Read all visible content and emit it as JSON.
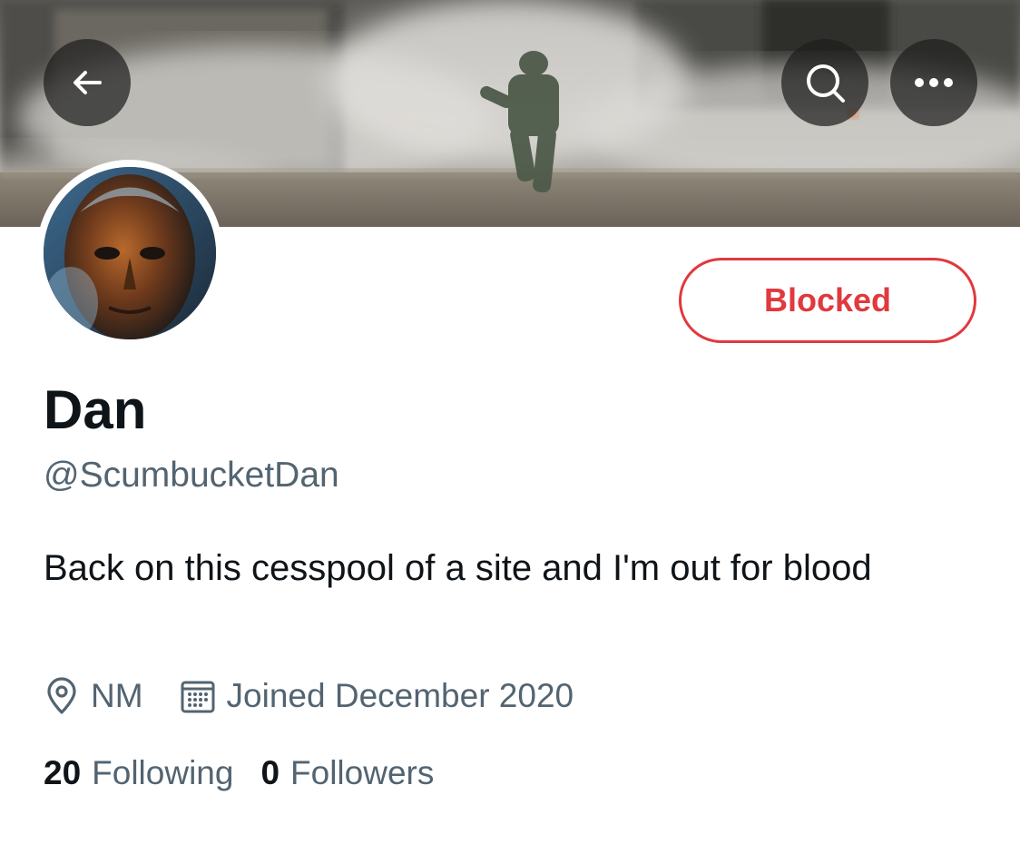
{
  "profile": {
    "display_name": "Dan",
    "handle": "@ScumbucketDan",
    "bio": "Back on this cesspool of a site and I'm out for blood",
    "location": "NM",
    "joined": "Joined December 2020",
    "following_count": "20",
    "following_label": "Following",
    "followers_count": "0",
    "followers_label": "Followers"
  },
  "actions": {
    "blocked_label": "Blocked"
  },
  "icons": {
    "back": "arrow-left-icon",
    "search": "search-icon",
    "more": "more-icon",
    "location": "location-pin-icon",
    "calendar": "calendar-icon"
  },
  "colors": {
    "blocked": "#e0393e",
    "primary_text": "#0f1419",
    "secondary_text": "#536471"
  }
}
